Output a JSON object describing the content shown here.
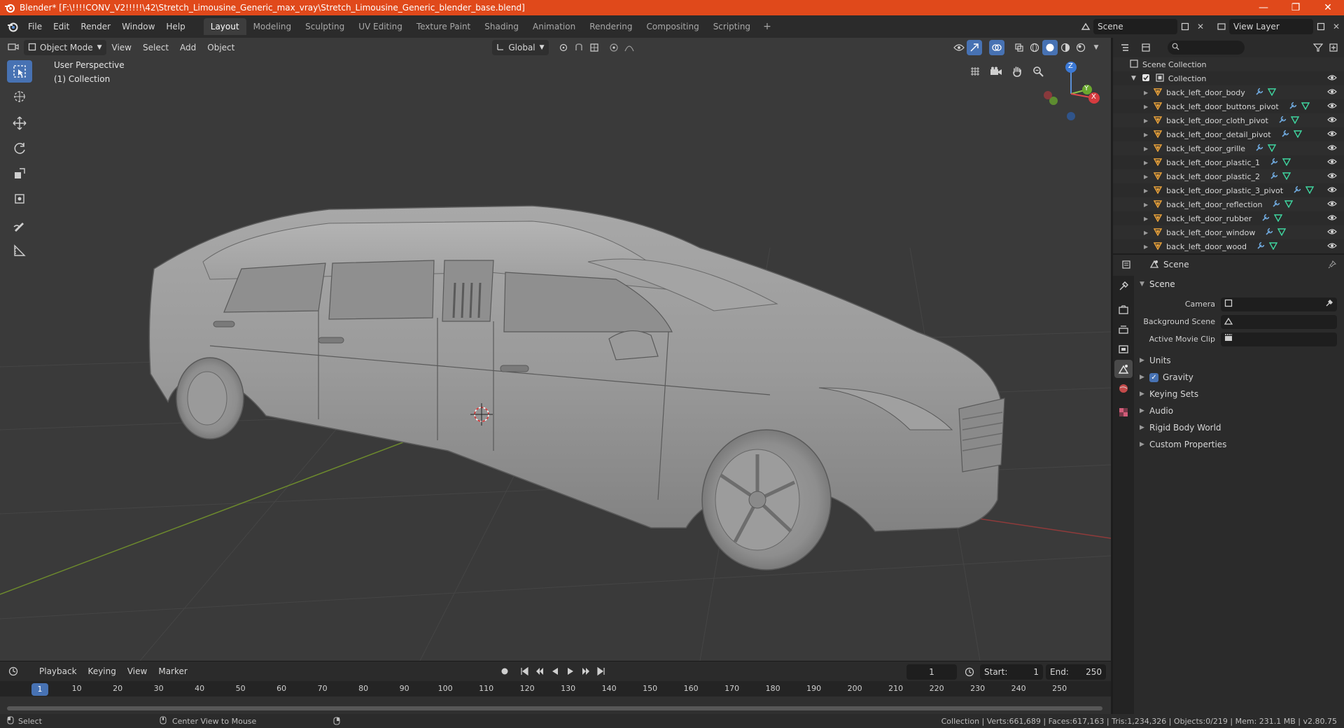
{
  "window": {
    "title": "Blender* [F:\\!!!!CONV_V2!!!!!\\42\\Stretch_Limousine_Generic_max_vray\\Stretch_Limousine_Generic_blender_base.blend]",
    "minimize": "—",
    "maximize": "❐",
    "close": "✕"
  },
  "menu": [
    "File",
    "Edit",
    "Render",
    "Window",
    "Help"
  ],
  "workspaces": [
    "Layout",
    "Modeling",
    "Sculpting",
    "UV Editing",
    "Texture Paint",
    "Shading",
    "Animation",
    "Rendering",
    "Compositing",
    "Scripting"
  ],
  "workspace_add": "+",
  "topbar_right": {
    "scene": "Scene",
    "view_layer": "View Layer"
  },
  "viewport": {
    "mode": "Object Mode",
    "menus": [
      "View",
      "Select",
      "Add",
      "Object"
    ],
    "transform_orientation": "Global",
    "overlay_line1": "User Perspective",
    "overlay_line2": "(1) Collection",
    "gizmo": {
      "z": "Z",
      "y": "Y",
      "x": "X"
    }
  },
  "timeline": {
    "menus": [
      "Playback",
      "Keying",
      "View",
      "Marker"
    ],
    "current_frame": "1",
    "start_label": "Start:",
    "start": "1",
    "end_label": "End:",
    "end": "250",
    "ticks": [
      "1",
      "10",
      "20",
      "30",
      "40",
      "50",
      "60",
      "70",
      "80",
      "90",
      "100",
      "110",
      "120",
      "130",
      "140",
      "150",
      "160",
      "170",
      "180",
      "190",
      "200",
      "210",
      "220",
      "230",
      "240",
      "250"
    ]
  },
  "statusbar": {
    "select": "Select",
    "center_view": "Center View to Mouse",
    "stats": "Collection | Verts:661,689 | Faces:617,163 | Tris:1,234,326 | Objects:0/219 | Mem: 231.1 MB | v2.80.75"
  },
  "outliner": {
    "scene_collection": "Scene Collection",
    "collection": "Collection",
    "items": [
      "back_left_door_body",
      "back_left_door_buttons_pivot",
      "back_left_door_cloth_pivot",
      "back_left_door_detail_pivot",
      "back_left_door_grille",
      "back_left_door_plastic_1",
      "back_left_door_plastic_2",
      "back_left_door_plastic_3_pivot",
      "back_left_door_reflection",
      "back_left_door_rubber",
      "back_left_door_window",
      "back_left_door_wood"
    ]
  },
  "properties": {
    "header": "Scene",
    "panel": "Scene",
    "rows": [
      {
        "label": "Camera",
        "value": ""
      },
      {
        "label": "Background Scene",
        "value": ""
      },
      {
        "label": "Active Movie Clip",
        "value": ""
      }
    ],
    "subpanels": [
      "Units",
      "Gravity",
      "Keying Sets",
      "Audio",
      "Rigid Body World",
      "Custom Properties"
    ],
    "gravity_check": "✓"
  },
  "colors": {
    "accent": "#4772b3",
    "titlebar": "#e0491b",
    "object_orange": "#e8a13a",
    "modifier_blue": "#6fa8dc",
    "mesh_green": "#3fd6a0"
  }
}
